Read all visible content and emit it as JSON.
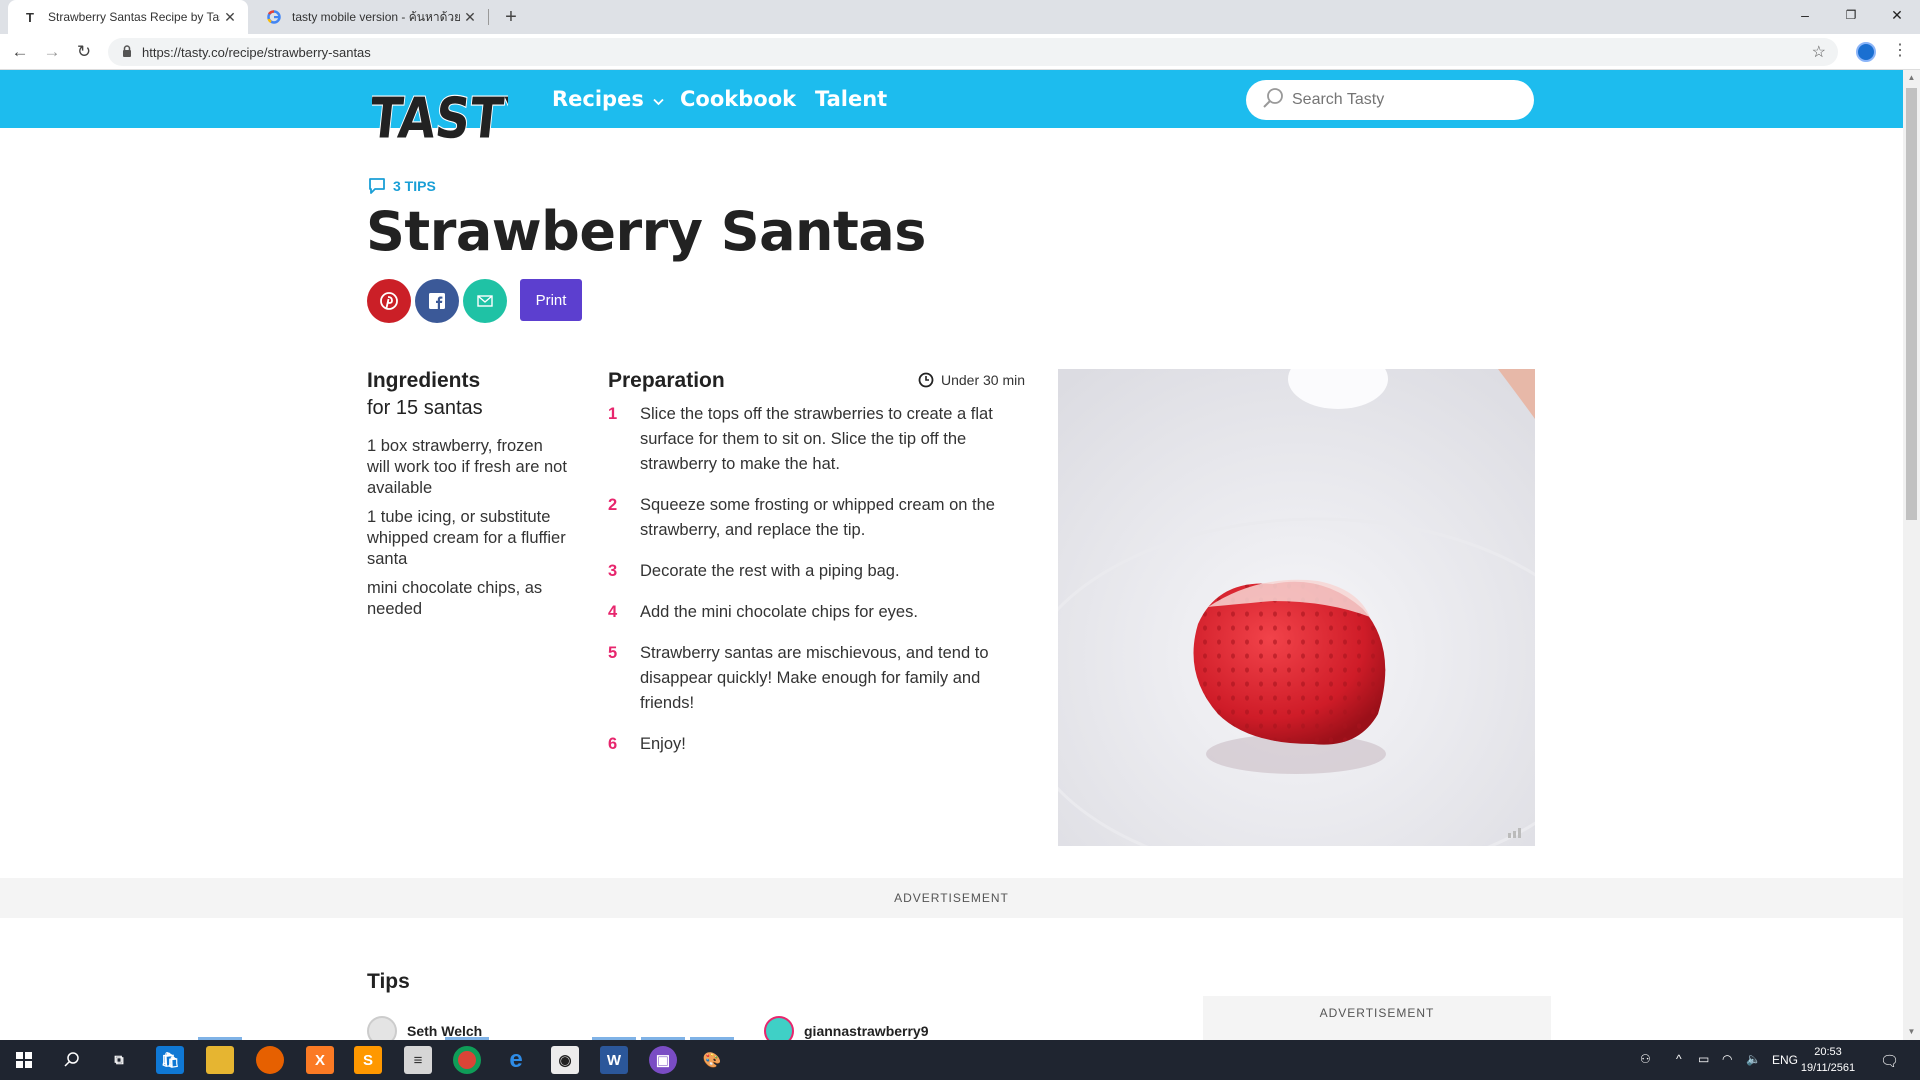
{
  "browser": {
    "tabs": [
      {
        "title": "Strawberry Santas Recipe by Tast",
        "favicon": "T"
      },
      {
        "title": "tasty mobile version - ค้นหาด้วย G",
        "favicon": "G"
      }
    ],
    "url": "https://tasty.co/recipe/strawberry-santas",
    "new_tab_label": "+",
    "window_controls": {
      "minimize": "–",
      "restore": "❐",
      "close": "✕"
    }
  },
  "site": {
    "logo_text": "TASTY",
    "nav": {
      "recipes": "Recipes",
      "cookbook": "Cookbook",
      "talent": "Talent"
    },
    "search_placeholder": "Search Tasty",
    "brand_color": "#1dbcee"
  },
  "recipe": {
    "tips_count_label": "3 TIPS",
    "title": "Strawberry Santas",
    "print_label": "Print",
    "ingredients_heading": "Ingredients",
    "servings": "for 15 santas",
    "ingredients": [
      "1 box strawberry, frozen will work too if fresh are not available",
      "1 tube icing, or substitute whipped cream for a fluffier santa",
      "mini chocolate chips, as needed"
    ],
    "preparation_heading": "Preparation",
    "time": "Under 30 min",
    "steps": [
      {
        "num": "1",
        "text": "Slice the tops off the strawberries to create a flat surface for them to sit on. Slice the tip off the strawberry to make the hat."
      },
      {
        "num": "2",
        "text": "Squeeze some frosting or whipped cream on the strawberry, and replace the tip."
      },
      {
        "num": "3",
        "text": "Decorate the rest with a piping bag."
      },
      {
        "num": "4",
        "text": "Add the mini chocolate chips for eyes."
      },
      {
        "num": "5",
        "text": "Strawberry santas are mischievous, and tend to disappear quickly! Make enough for family and friends!"
      },
      {
        "num": "6",
        "text": "Enjoy!"
      }
    ]
  },
  "advertisement_label": "ADVERTISEMENT",
  "tips_section": {
    "heading": "Tips",
    "authors": [
      "Seth Welch",
      "giannastrawberry9"
    ]
  },
  "taskbar": {
    "language": "ENG",
    "time": "20:53",
    "date": "19/11/2561"
  }
}
